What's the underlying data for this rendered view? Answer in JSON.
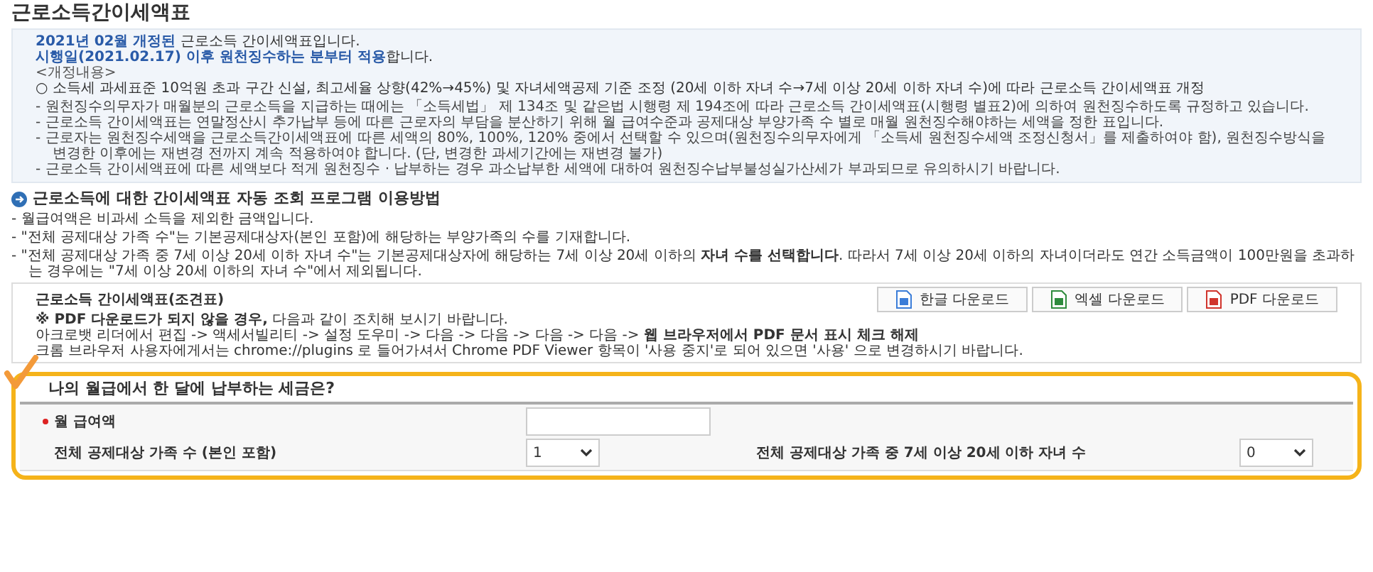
{
  "title": "근로소득간이세액표",
  "notice": {
    "highlights": [
      "**2021년 02월 개정된** 근로소득 간이세액표입니다.",
      "**시행일(2021.02.17) 이후 원천징수하는 분부터 적용**합니다."
    ],
    "revision_label": "<개정내용>",
    "revision": "○ 소득세 과세표준 10억원 초과 구간 신설, 최고세율 상향(42%→45%) 및 자녀세액공제 기준 조정 (20세 이하 자녀 수→7세 이상 20세 이하 자녀 수)에 따라 근로소득 간이세액표 개정",
    "items": [
      "- 원천징수의무자가 매월분의 근로소득을 지급하는 때에는 「소득세법」 제 134조 및 같은법 시행령 제 194조에 따라 근로소득 간이세액표(시행령 별표2)에 의하여 원천징수하도록 규정하고 있습니다.",
      "- 근로소득 간이세액표는 연말정산시 추가납부 등에 따른 근로자의 부담을 분산하기 위해 월 급여수준과 공제대상 부양가족 수 별로 매월 원천징수해야하는 세액을 정한 표입니다.",
      "- 근로자는 원천징수세액을 근로소득간이세액표에 따른 세액의 80%, 100%, 120% 중에서 선택할 수 있으며(원천징수의무자에게 「소득세 원천징수세액 조정신청서」를 제출하여야 함), 원천징수방식을 변경한 이후에는 재변경 전까지 계속 적용하여야 합니다. (단, 변경한 과세기간에는 재변경 불가)",
      "- 근로소득 간이세액표에 따른 세액보다 적게 원천징수 · 납부하는 경우 과소납부한 세액에 대하여 원천징수납부불성실가산세가 부과되므로 유의하시기 바랍니다."
    ]
  },
  "guide": {
    "heading": "근로소득에 대한 간이세액표 자동 조회 프로그램 이용방법",
    "items": [
      "- 월급여액은 비과세 소득을 제외한 금액입니다.",
      "- \"전체 공제대상 가족 수\"는 기본공제대상자(본인 포함)에 해당하는 부양가족의 수를 기재합니다.",
      "- \"전체 공제대상 가족 중 7세 이상 20세 이하 자녀 수\"는 기본공제대상자에 해당하는 7세 이상 20세 이하의 **자녀 수를 선택합니다**. 따라서 7세 이상 20세 이하의 자녀이더라도 연간 소득금액이 100만원을 초과하는 경우에는 \"7세 이상 20세 이하의 자녀 수\"에서 제외됩니다."
    ]
  },
  "downloads": {
    "title": "근로소득 간이세액표(조견표)",
    "buttons": [
      {
        "kind": "hwp",
        "label": "한글 다운로드"
      },
      {
        "kind": "excel",
        "label": "엑셀 다운로드"
      },
      {
        "kind": "pdf",
        "label": "PDF 다운로드"
      }
    ],
    "notes": [
      "**※ PDF 다운로드가 되지 않을 경우,** 다음과 같이 조치해 보시기 바랍니다.",
      "아크로뱃 리더에서 편집 -> 액세서빌리티 -> 설정 도우미 -> 다음 -> 다음 -> 다음 -> 다음 -> **웹 브라우저에서 PDF 문서 표시 체크 해제**",
      "크롬 브라우저 사용자에게서는 chrome://plugins 로 들어가셔서 Chrome PDF Viewer 항목이 '사용 중지'로 되어 있으면 '사용' 으로 변경하시기 바랍니다."
    ]
  },
  "calculator": {
    "heading": "나의 월급에서 한 달에 납부하는 세금은?",
    "salary": {
      "label": "월 급여액",
      "required": true
    },
    "family": {
      "label": "전체 공제대상 가족 수 (본인 포함)",
      "value": "1"
    },
    "children": {
      "label": "전체 공제대상 가족 중 7세 이상 20세 이하 자녀 수",
      "value": "0"
    }
  }
}
